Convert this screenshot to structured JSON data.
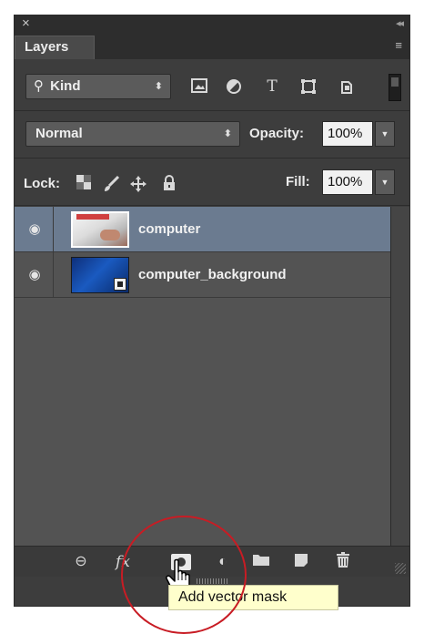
{
  "panel": {
    "close_glyph": "×",
    "collapse_glyph": "◂◂",
    "tab_label": "Layers",
    "menu_glyph": "≡"
  },
  "filter": {
    "kind_label": "Kind",
    "search_glyph": "⚲",
    "icons": [
      "image-filter-icon",
      "adjustment-filter-icon",
      "type-filter-icon",
      "shape-filter-icon",
      "smart-object-filter-icon"
    ],
    "type_glyph": "T"
  },
  "blend": {
    "mode": "Normal",
    "opacity_label": "Opacity:",
    "opacity_value": "100%"
  },
  "lock": {
    "label": "Lock:",
    "fill_label": "Fill:",
    "fill_value": "100%"
  },
  "layers": [
    {
      "name": "computer",
      "visible": true,
      "selected": true
    },
    {
      "name": "computer_background",
      "visible": true,
      "selected": false
    }
  ],
  "toolbar": {
    "link_glyph": "⊖",
    "fx_label": "fx",
    "adjust_glyph": "◐",
    "folder_glyph": "▬",
    "new_layer_glyph": "❐",
    "trash_glyph": "🗑"
  },
  "tooltip": {
    "text": "Add vector mask"
  },
  "colors": {
    "panel": "#3d3d3d",
    "selected_row": "#6b7b90",
    "highlight": "#c81c24",
    "tooltip_bg": "#ffffcc"
  }
}
